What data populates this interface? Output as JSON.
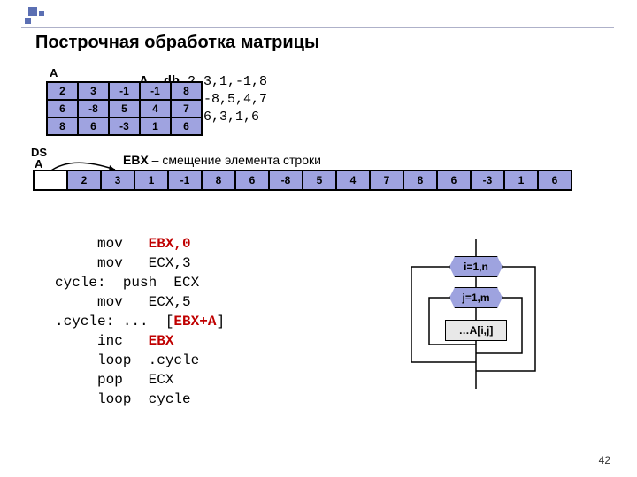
{
  "title": "Построчная обработка матрицы",
  "matrix_label": "A",
  "matrix_def_line1_a": "A  db ",
  "matrix_def_line1_b": "2,3,1,-1,8",
  "matrix_def_line2": "   db 6,-8,5,4,7",
  "matrix_def_line3": "   db 8,6,3,1,6",
  "matrix": {
    "r0": [
      "2",
      "3",
      "-1",
      "-1",
      "8"
    ],
    "r1": [
      "6",
      "-8",
      "5",
      "4",
      "7"
    ],
    "r2": [
      "8",
      "6",
      "-3",
      "1",
      "6"
    ]
  },
  "ds_label": "DS",
  "a_label2": "A",
  "ebx_label": "EBX",
  "ebx_rest": " – смещение элемента строки",
  "memory": [
    "2",
    "3",
    "1",
    "-1",
    "8",
    "6",
    "-8",
    "5",
    "4",
    "7",
    "8",
    "6",
    "-3",
    "1",
    "6"
  ],
  "code_lines": [
    {
      "pre": "     mov   ",
      "red": "EBX,0",
      "post": ""
    },
    {
      "pre": "     mov   ECX,3",
      "red": "",
      "post": ""
    },
    {
      "pre": "cycle:  push  ECX",
      "red": "",
      "post": ""
    },
    {
      "pre": "     mov   ECX,5",
      "red": "",
      "post": ""
    },
    {
      "pre": ".cycle: ...  [",
      "red": "EBX+A",
      "post": "]"
    },
    {
      "pre": "     inc   ",
      "red": "EBX",
      "post": ""
    },
    {
      "pre": "     loop  .cycle",
      "red": "",
      "post": ""
    },
    {
      "pre": "     pop   ECX",
      "red": "",
      "post": ""
    },
    {
      "pre": "     loop  cycle",
      "red": "",
      "post": ""
    }
  ],
  "flow": {
    "box1": "i=1,n",
    "box2": "j=1,m",
    "box3": "…A[i,j]"
  },
  "page_num": "42",
  "chart_data": {
    "type": "table",
    "matrix_2d": [
      [
        2,
        3,
        -1,
        -1,
        8
      ],
      [
        6,
        -8,
        5,
        4,
        7
      ],
      [
        8,
        6,
        -3,
        1,
        6
      ]
    ],
    "memory_linear": [
      2,
      3,
      1,
      -1,
      8,
      6,
      -8,
      5,
      4,
      7,
      8,
      6,
      -3,
      1,
      6
    ]
  }
}
